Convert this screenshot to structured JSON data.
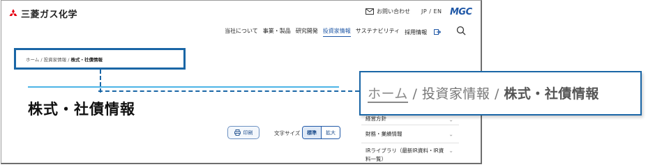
{
  "header": {
    "company_name": "三菱ガス化学",
    "contact_label": "お問い合わせ",
    "lang_switch": "JP / EN",
    "brand": "MGC"
  },
  "nav": {
    "items": [
      {
        "label": "当社について"
      },
      {
        "label": "事業・製品"
      },
      {
        "label": "研究開発"
      },
      {
        "label": "投資家情報",
        "active": true
      },
      {
        "label": "サステナビリティ"
      },
      {
        "label": "採用情報"
      }
    ]
  },
  "breadcrumb": {
    "home": "ホーム",
    "sep": " / ",
    "parent": "投資家情報",
    "current": "株式・社債情報"
  },
  "page": {
    "title": "株式・社債情報",
    "print_label": "印刷",
    "font_size_label": "文字サイズ",
    "font_std": "標準",
    "font_large": "拡大"
  },
  "sidebar": {
    "partial_top": "経営方針",
    "items": [
      {
        "label": "財務・業績情報"
      },
      {
        "label": "IRライブラリ（最新IR資料・IR資料一覧）"
      }
    ]
  },
  "zoom": {
    "home": "ホーム",
    "sep": " / ",
    "parent": "投資家情報",
    "current": "株式・社債情報"
  },
  "colors": {
    "accent": "#1f57a6",
    "highlight_border": "#1a66a6",
    "title_rule": "#4cb4e6",
    "logo_red": "#e60012"
  }
}
